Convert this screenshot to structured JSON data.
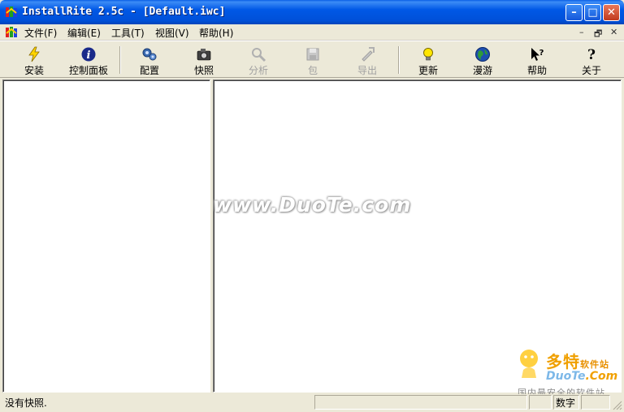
{
  "window": {
    "title": "InstallRite 2.5c - [Default.iwc]",
    "minimize_glyph": "–",
    "maximize_glyph": "□",
    "close_glyph": "✕"
  },
  "menu": {
    "items": [
      {
        "label": "文件(F)"
      },
      {
        "label": "编辑(E)"
      },
      {
        "label": "工具(T)"
      },
      {
        "label": "视图(V)"
      },
      {
        "label": "帮助(H)"
      }
    ],
    "mdi_min": "–",
    "mdi_restore": "🗗",
    "mdi_close": "✕"
  },
  "toolbar": {
    "buttons": [
      {
        "label": "安装",
        "icon": "lightning-icon",
        "enabled": true
      },
      {
        "label": "控制面板",
        "icon": "info-icon",
        "enabled": true
      },
      {
        "label": "配置",
        "icon": "config-icon",
        "enabled": true
      },
      {
        "label": "快照",
        "icon": "camera-icon",
        "enabled": true
      },
      {
        "label": "分析",
        "icon": "magnifier-icon",
        "enabled": false
      },
      {
        "label": "包",
        "icon": "floppy-icon",
        "enabled": false
      },
      {
        "label": "导出",
        "icon": "export-icon",
        "enabled": false
      },
      {
        "label": "更新",
        "icon": "lightbulb-icon",
        "enabled": true
      },
      {
        "label": "漫游",
        "icon": "globe-icon",
        "enabled": true
      },
      {
        "label": "帮助",
        "icon": "help-arrow-icon",
        "enabled": true
      },
      {
        "label": "关于",
        "icon": "question-icon",
        "enabled": true
      }
    ]
  },
  "watermark": {
    "text": "www.DuoTe.com"
  },
  "logo": {
    "main": "多特",
    "main_small": "软件站",
    "sub_a": "DuoTe",
    "sub_b": ".Com",
    "tagline": "国内最安全的软件站"
  },
  "statusbar": {
    "text": "没有快照.",
    "num_indicator": "数字"
  },
  "colors": {
    "titlebar": "#0058E6",
    "close_button": "#C13A1E",
    "face": "#ECE9D8"
  }
}
